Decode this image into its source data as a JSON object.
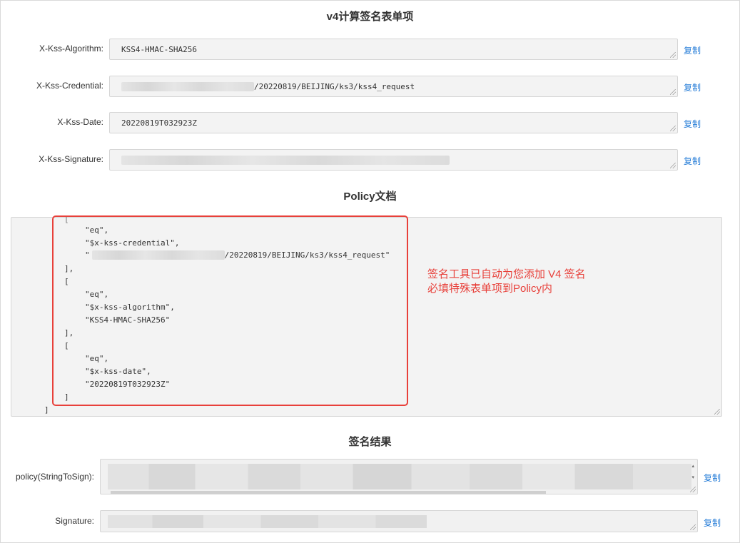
{
  "sections": {
    "v4_title": "v4计算签名表单项",
    "policy_title": "Policy文档",
    "result_title": "签名结果"
  },
  "fields": [
    {
      "label": "X-Kss-Algorithm:",
      "value": "KSS4-HMAC-SHA256",
      "copy": "复制"
    },
    {
      "label": "X-Kss-Credential:",
      "value_suffix": "/20220819/BEIJING/ks3/kss4_request",
      "copy": "复制"
    },
    {
      "label": "X-Kss-Date:",
      "value": "20220819T032923Z",
      "copy": "复制"
    },
    {
      "label": "X-Kss-Signature:",
      "copy": "复制"
    }
  ],
  "policy_doc": {
    "lines": [
      "\"eq\",",
      "\"$x-kss-credential\",",
      "/20220819/BEIJING/ks3/kss4_request\"",
      "],",
      "[",
      "\"eq\",",
      "\"$x-kss-algorithm\",",
      "\"KSS4-HMAC-SHA256\"",
      "],",
      "[",
      "\"eq\",",
      "\"$x-kss-date\",",
      "\"20220819T032923Z\"",
      "]",
      "]"
    ],
    "quote_open": "\"",
    "annotation_line1": "签名工具已自动为您添加 V4 签名",
    "annotation_line2": "必填特殊表单项到Policy内"
  },
  "results": [
    {
      "label": "policy(StringToSign):",
      "copy": "复制"
    },
    {
      "label": "Signature:",
      "copy": "复制"
    }
  ],
  "colors": {
    "accent_link": "#2a7fd8",
    "highlight_red": "#e8403a",
    "field_bg": "#f3f3f3"
  }
}
